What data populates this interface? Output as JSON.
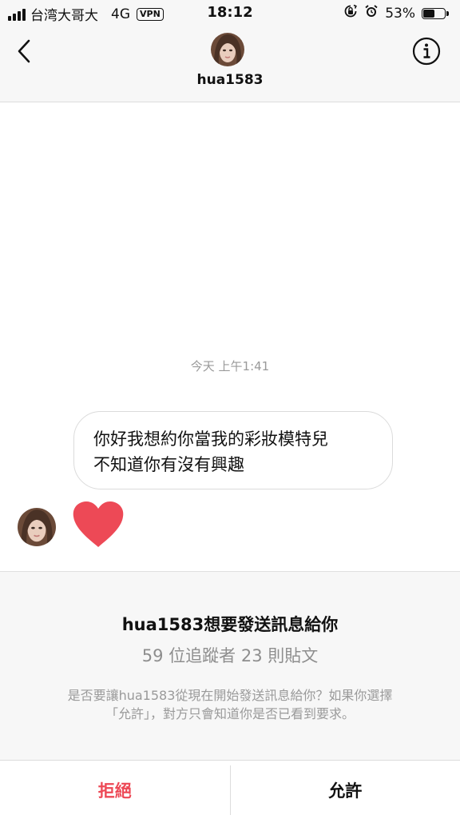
{
  "status_bar": {
    "carrier": "台湾大哥大",
    "network": "4G",
    "vpn": "VPN",
    "time": "18:12",
    "battery_percent": "53%",
    "battery_level": 0.53,
    "icons": [
      "signal-icon",
      "rotation-lock-icon",
      "alarm-icon",
      "battery-icon"
    ]
  },
  "header": {
    "username": "hua1583",
    "back_icon": "chevron-left-icon",
    "info_icon": "info-icon"
  },
  "conversation": {
    "timestamp": "今天 上午1:41",
    "messages": [
      {
        "lines": [
          "你好我想約你當我的彩妝模特兒",
          "不知道你有沒有興趣"
        ]
      },
      {
        "icon": "heart-icon",
        "color": "#ed4956"
      }
    ]
  },
  "request": {
    "title": "hua1583想要發送訊息給你",
    "stats": "59 位追蹤者 23 則貼文",
    "description_line1": "是否要讓hua1583從現在開始發送訊息給你？如果你選擇",
    "description_line2": "「允許」，對方只會知道你是否已看到要求。"
  },
  "actions": {
    "decline_label": "拒絕",
    "allow_label": "允許",
    "decline_color": "#ed4956"
  }
}
